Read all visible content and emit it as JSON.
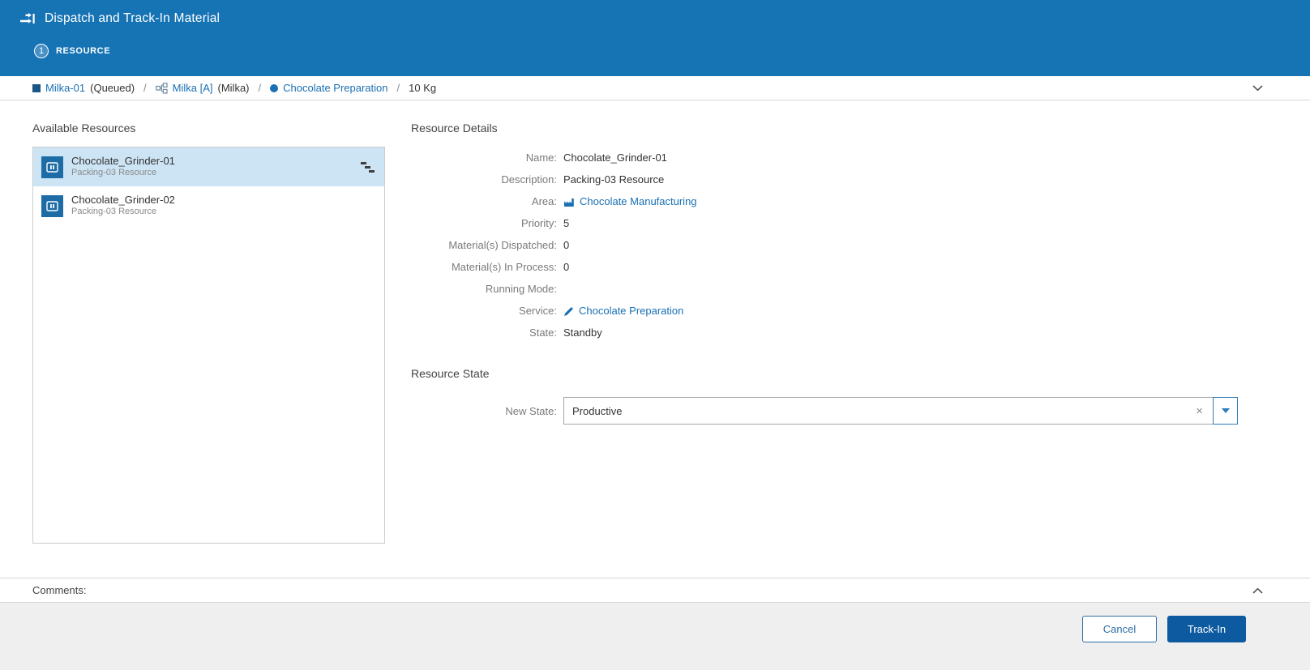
{
  "header": {
    "title": "Dispatch and Track-In Material",
    "step_number": "1",
    "step_label": "RESOURCE"
  },
  "breadcrumb": {
    "separator": "/",
    "material": {
      "name": "Milka-01",
      "state": "(Queued)"
    },
    "flow": {
      "name": "Milka [A]",
      "suffix": "(Milka)"
    },
    "step": {
      "name": "Chocolate Preparation"
    },
    "quantity": "10 Kg"
  },
  "available_resources": {
    "title": "Available Resources",
    "items": [
      {
        "name": "Chocolate_Grinder-01",
        "description": "Packing-03 Resource",
        "selected": true
      },
      {
        "name": "Chocolate_Grinder-02",
        "description": "Packing-03 Resource",
        "selected": false
      }
    ]
  },
  "resource_details": {
    "title": "Resource Details",
    "rows": [
      {
        "label": "Name:",
        "value": "Chocolate_Grinder-01"
      },
      {
        "label": "Description:",
        "value": "Packing-03 Resource"
      },
      {
        "label": "Area:",
        "value": "Chocolate Manufacturing",
        "link": true,
        "icon": "area-icon"
      },
      {
        "label": "Priority:",
        "value": "5"
      },
      {
        "label": "Material(s) Dispatched:",
        "value": "0"
      },
      {
        "label": "Material(s) In Process:",
        "value": "0"
      },
      {
        "label": "Running Mode:",
        "value": ""
      },
      {
        "label": "Service:",
        "value": "Chocolate Preparation",
        "link": true,
        "icon": "service-icon"
      },
      {
        "label": "State:",
        "value": "Standby"
      }
    ]
  },
  "resource_state": {
    "title": "Resource State",
    "label": "New State:",
    "value": "Productive",
    "clear_icon": "×"
  },
  "comments": {
    "label": "Comments:"
  },
  "footer": {
    "cancel": "Cancel",
    "track_in": "Track-In"
  },
  "colors": {
    "header_blue": "#1673B4",
    "link_blue": "#1A70B4",
    "selected_item_bg": "#CDE4F5",
    "trackin_button_bg": "#0D5AA0",
    "footer_bg": "#EFEFEF"
  }
}
